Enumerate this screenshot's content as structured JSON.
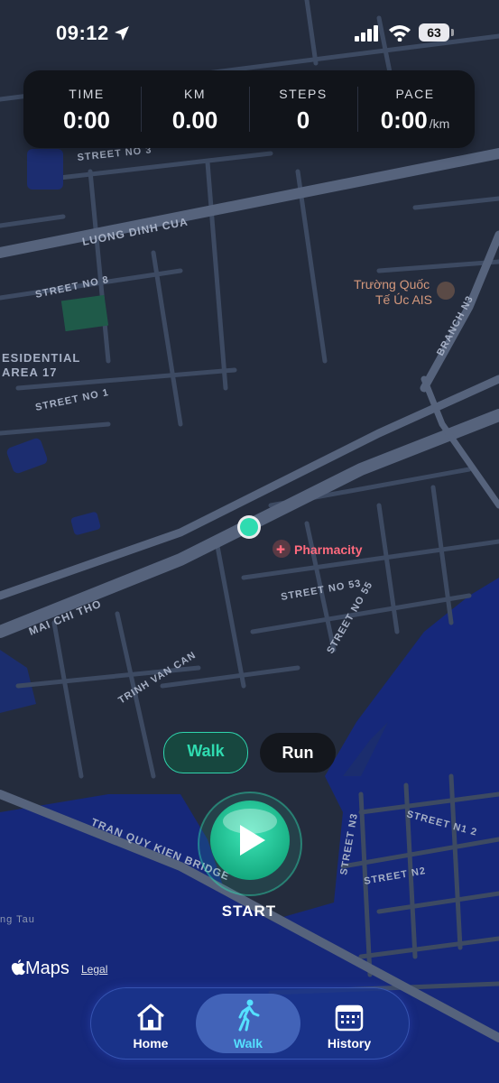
{
  "status_bar": {
    "time": "09:12",
    "battery": "63"
  },
  "stats": [
    {
      "label": "TIME",
      "value": "0:00",
      "unit": ""
    },
    {
      "label": "KM",
      "value": "0.00",
      "unit": ""
    },
    {
      "label": "STEPS",
      "value": "0",
      "unit": ""
    },
    {
      "label": "PACE",
      "value": "0:00",
      "unit": "/km"
    }
  ],
  "map": {
    "labels": {
      "street_no_3": "STREET NO 3",
      "luong_dinh_cua": "LUONG DINH CUA",
      "street_no_8": "STREET NO 8",
      "residential_1": "ESIDENTIAL",
      "residential_2": "AREA 17",
      "street_no_1": "STREET NO 1",
      "truong_1": "Trường Quốc",
      "truong_2": "Tế Úc AIS",
      "branch_n3": "BRANCH N3",
      "pharmacity": "Pharmacity",
      "street_no_53": "STREET NO 53",
      "street_no_55": "STREET NO 55",
      "mai_chi_tho": "MAI CHI THO",
      "trinh_van_can": "TRINH VAN CAN",
      "tran_quy_kien_bridge": "TRAN QUY KIEN BRIDGE",
      "street_n3": "STREET N3",
      "street_n2": "STREET N2",
      "street_n1": "STREET N1 2",
      "ng_tau": "ng Tau"
    }
  },
  "mode": {
    "walk": "Walk",
    "run": "Run"
  },
  "start": {
    "label": "START"
  },
  "attribution": {
    "maps": "Maps",
    "legal": "Legal"
  },
  "tabs": [
    {
      "label": "Home",
      "icon": "home-icon"
    },
    {
      "label": "Walk",
      "icon": "walk-icon"
    },
    {
      "label": "History",
      "icon": "calendar-icon"
    }
  ],
  "colors": {
    "accent": "#2fdbb0",
    "map_bg": "#242c3d",
    "water": "#16287a",
    "tab_active": "#55e0ff"
  }
}
